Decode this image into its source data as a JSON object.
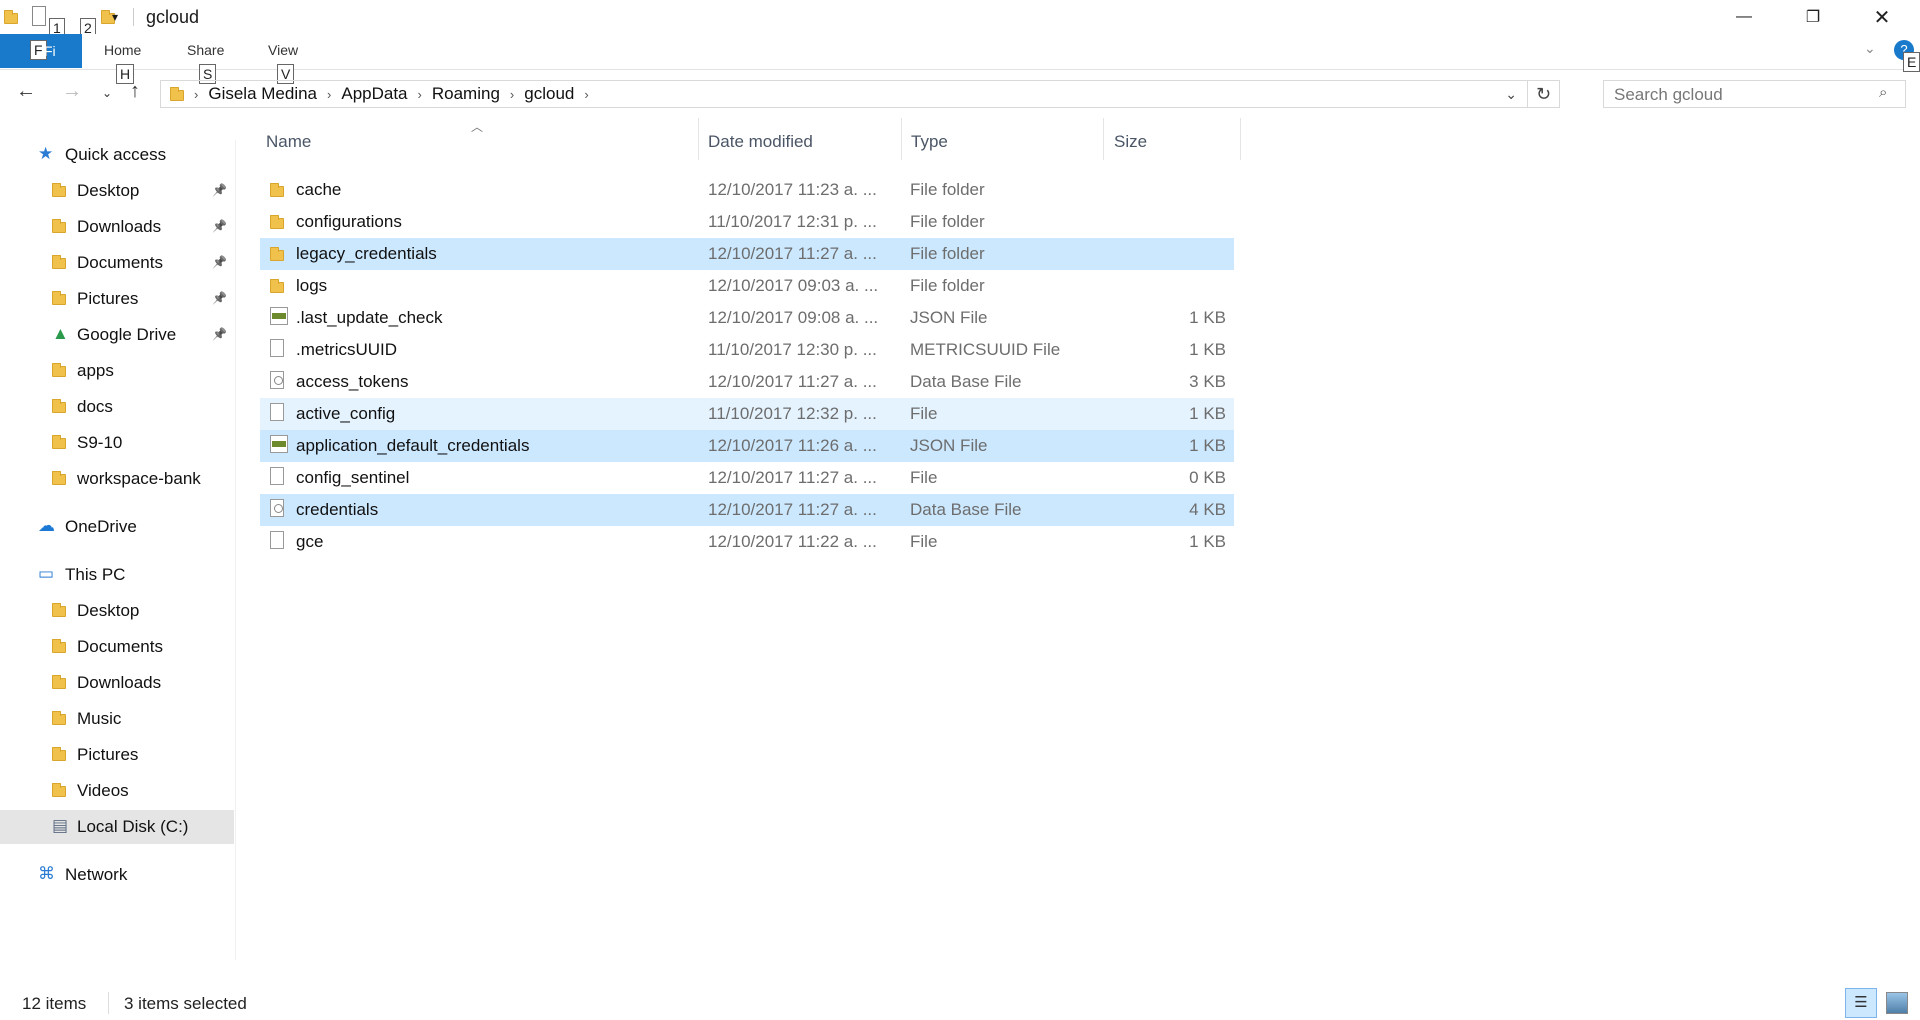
{
  "window": {
    "title": "gcloud",
    "keytips": {
      "qat1": "1",
      "qat2": "2",
      "file": "F",
      "home": "H",
      "share": "S",
      "view": "V",
      "help": "E"
    },
    "controls": {
      "minimize": "—",
      "maximize": "❐",
      "close": "✕"
    }
  },
  "ribbon": {
    "file_label": "Fi",
    "tabs": [
      {
        "label": "Home",
        "keytip": "H"
      },
      {
        "label": "Share",
        "keytip": "S"
      },
      {
        "label": "View",
        "keytip": "V"
      }
    ]
  },
  "address": {
    "segments": [
      "Gisela Medina",
      "AppData",
      "Roaming",
      "gcloud"
    ]
  },
  "search": {
    "placeholder": "Search gcloud"
  },
  "sidebar": {
    "items": [
      {
        "label": "Quick access",
        "icon": "star-icon",
        "level": 0
      },
      {
        "label": "Desktop",
        "icon": "folder-desktop-icon",
        "level": 1,
        "pinned": true
      },
      {
        "label": "Downloads",
        "icon": "folder-downloads-icon",
        "level": 1,
        "pinned": true
      },
      {
        "label": "Documents",
        "icon": "folder-documents-icon",
        "level": 1,
        "pinned": true
      },
      {
        "label": "Pictures",
        "icon": "folder-pictures-icon",
        "level": 1,
        "pinned": true
      },
      {
        "label": "Google Drive",
        "icon": "google-drive-icon",
        "level": 1,
        "pinned": true
      },
      {
        "label": "apps",
        "icon": "folder-icon",
        "level": 1
      },
      {
        "label": "docs",
        "icon": "folder-icon",
        "level": 1
      },
      {
        "label": "S9-10",
        "icon": "folder-icon",
        "level": 1
      },
      {
        "label": "workspace-bank",
        "icon": "folder-icon",
        "level": 1
      },
      {
        "label": "OneDrive",
        "icon": "cloud-icon",
        "level": 0
      },
      {
        "label": "This PC",
        "icon": "computer-icon",
        "level": 0
      },
      {
        "label": "Desktop",
        "icon": "folder-desktop-icon",
        "level": 1
      },
      {
        "label": "Documents",
        "icon": "folder-documents-icon",
        "level": 1
      },
      {
        "label": "Downloads",
        "icon": "folder-downloads-icon",
        "level": 1
      },
      {
        "label": "Music",
        "icon": "folder-music-icon",
        "level": 1
      },
      {
        "label": "Pictures",
        "icon": "folder-pictures-icon",
        "level": 1
      },
      {
        "label": "Videos",
        "icon": "folder-videos-icon",
        "level": 1
      },
      {
        "label": "Local Disk (C:)",
        "icon": "drive-icon",
        "level": 1,
        "selected": true
      },
      {
        "label": "Network",
        "icon": "network-icon",
        "level": 0
      }
    ]
  },
  "filelist": {
    "columns": [
      "Name",
      "Date modified",
      "Type",
      "Size"
    ],
    "rows": [
      {
        "name": "cache",
        "date": "12/10/2017 11:23 a. ...",
        "type": "File folder",
        "size": "",
        "icon": "folder-icon"
      },
      {
        "name": "configurations",
        "date": "11/10/2017 12:31 p. ...",
        "type": "File folder",
        "size": "",
        "icon": "folder-icon"
      },
      {
        "name": "legacy_credentials",
        "date": "12/10/2017 11:27 a. ...",
        "type": "File folder",
        "size": "",
        "icon": "folder-icon",
        "state": "selected"
      },
      {
        "name": "logs",
        "date": "12/10/2017 09:03 a. ...",
        "type": "File folder",
        "size": "",
        "icon": "folder-icon"
      },
      {
        "name": ".last_update_check",
        "date": "12/10/2017 09:08 a. ...",
        "type": "JSON File",
        "size": "1 KB",
        "icon": "json-file-icon"
      },
      {
        "name": ".metricsUUID",
        "date": "11/10/2017 12:30 p. ...",
        "type": "METRICSUUID File",
        "size": "1 KB",
        "icon": "file-icon"
      },
      {
        "name": "access_tokens",
        "date": "12/10/2017 11:27 a. ...",
        "type": "Data Base File",
        "size": "3 KB",
        "icon": "database-file-icon"
      },
      {
        "name": "active_config",
        "date": "11/10/2017 12:32 p. ...",
        "type": "File",
        "size": "1 KB",
        "icon": "file-icon",
        "state": "hover"
      },
      {
        "name": "application_default_credentials",
        "date": "12/10/2017 11:26 a. ...",
        "type": "JSON File",
        "size": "1 KB",
        "icon": "json-file-icon",
        "state": "selected"
      },
      {
        "name": "config_sentinel",
        "date": "12/10/2017 11:27 a. ...",
        "type": "File",
        "size": "0 KB",
        "icon": "file-icon"
      },
      {
        "name": "credentials",
        "date": "12/10/2017 11:27 a. ...",
        "type": "Data Base File",
        "size": "4 KB",
        "icon": "database-file-icon",
        "state": "selected"
      },
      {
        "name": "gce",
        "date": "12/10/2017 11:22 a. ...",
        "type": "File",
        "size": "1 KB",
        "icon": "file-icon"
      }
    ]
  },
  "status": {
    "item_count": "12 items",
    "selected_count": "3 items selected"
  },
  "colors": {
    "selection": "#cce8ff",
    "hover": "#e5f3ff",
    "file_tab": "#1979ca",
    "folder": "#f0c24b"
  }
}
